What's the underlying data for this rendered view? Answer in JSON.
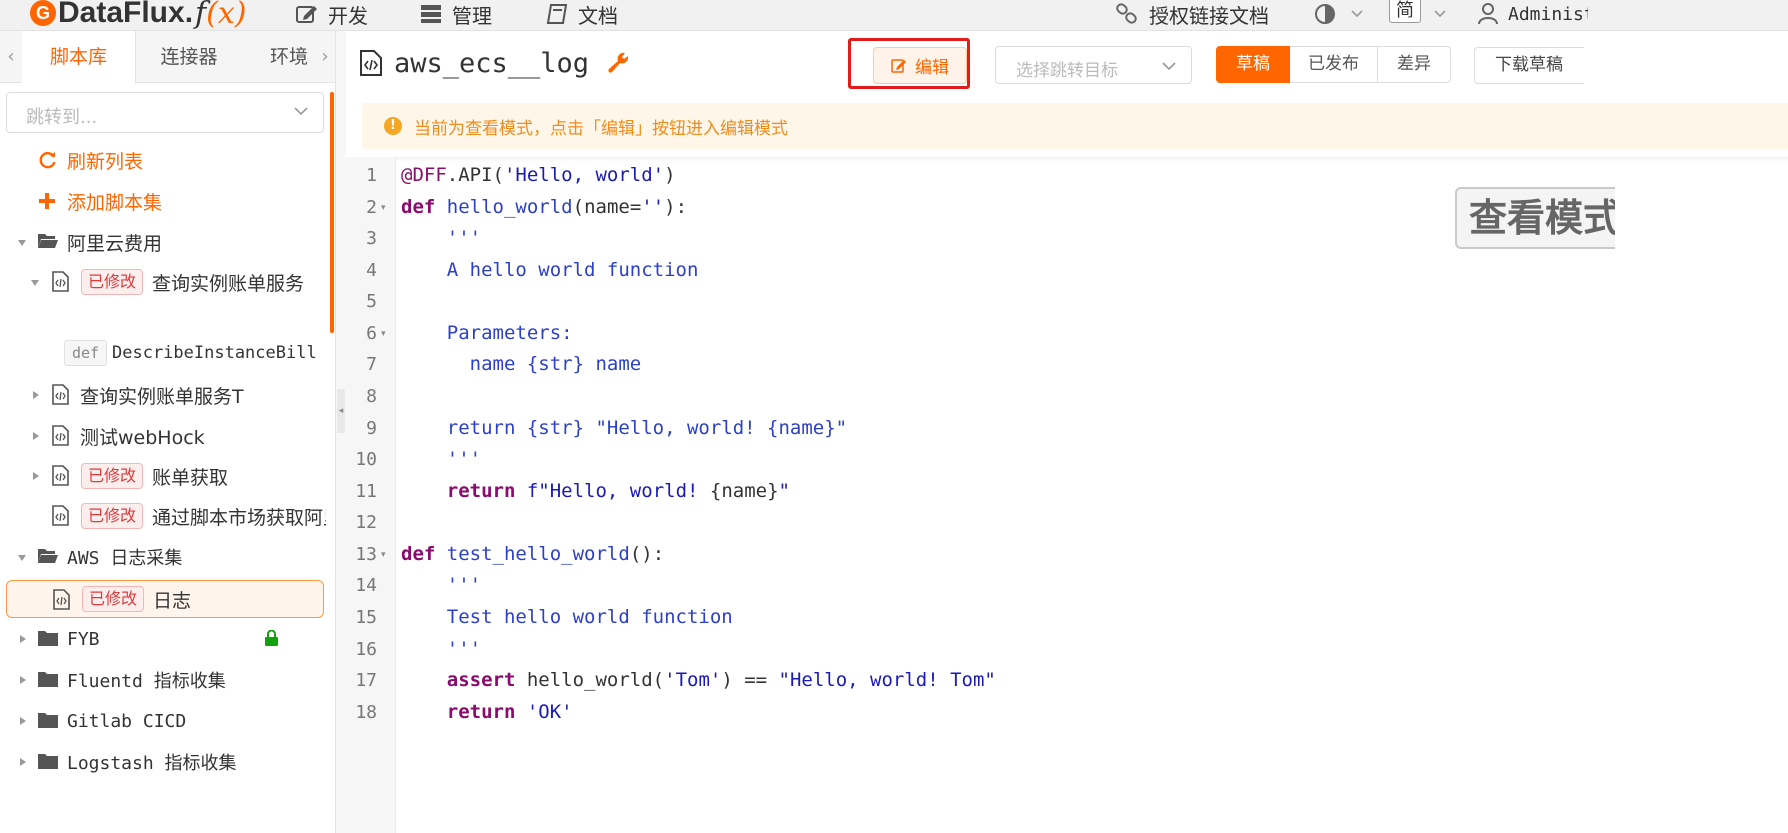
{
  "topbar": {
    "logo_text": "DataFlux.",
    "logo_fx": "f",
    "logo_x": "(x)",
    "nav": [
      "开发",
      "管理",
      "文档"
    ],
    "auth_doc_link": "授权链接文档",
    "lang": "简",
    "user": "Administrator"
  },
  "sidebar": {
    "tabs": [
      "脚本库",
      "连接器",
      "环境"
    ],
    "active_tab": "脚本库",
    "jump_placeholder": "跳转到...",
    "refresh": "刷新列表",
    "add_set": "添加脚本集",
    "items": [
      {
        "label": "阿里云费用",
        "type": "folder-open"
      },
      {
        "label": "查询实例账单服务",
        "type": "script",
        "badge": "已修改"
      },
      {
        "label": "DescribeInstanceBill",
        "type": "func",
        "badge": "def"
      },
      {
        "label": "查询实例账单服务T",
        "type": "script"
      },
      {
        "label": "测试webHock",
        "type": "script"
      },
      {
        "label": "账单获取",
        "type": "script",
        "badge": "已修改"
      },
      {
        "label": "通过脚本市场获取阿里",
        "type": "script",
        "badge": "已修改"
      },
      {
        "label": "AWS 日志采集",
        "type": "folder-open"
      },
      {
        "label": "日志",
        "type": "script",
        "badge": "已修改",
        "selected": true
      },
      {
        "label": "FYB",
        "type": "folder",
        "locked": true
      },
      {
        "label": "Fluentd 指标收集",
        "type": "folder"
      },
      {
        "label": "Gitlab CICD",
        "type": "folder"
      },
      {
        "label": "Logstash 指标收集",
        "type": "folder"
      }
    ]
  },
  "main": {
    "file_name": "aws_ecs__log",
    "edit_button": "编辑",
    "jump_target_placeholder": "选择跳转目标",
    "segments": [
      "草稿",
      "已发布",
      "差异"
    ],
    "active_segment": "草稿",
    "download_button": "下载草稿",
    "notice": "当前为查看模式，点击「编辑」按钮进入编辑模式",
    "view_mode_badge": "查看模式"
  },
  "code": {
    "line_numbers": [
      "1",
      "2",
      "3",
      "4",
      "5",
      "6",
      "7",
      "8",
      "9",
      "10",
      "11",
      "12",
      "13",
      "14",
      "15",
      "16",
      "17",
      "18"
    ],
    "l1_dec": "@DFF",
    "l1_rest": ".API(",
    "l1_str": "'Hello, world'",
    "l1_close": ")",
    "l2_kw": "def",
    "l2_fn": "hello_world",
    "l2_args": "(name=",
    "l2_str": "''",
    "l2_close": "):",
    "l3": "    '''",
    "l4": "    A hello world function",
    "l6": "    Parameters:",
    "l7": "      name {str} name",
    "l9": "    return {str} \"Hello, world! {name}\"",
    "l10": "    '''",
    "l11_kw": "return",
    "l11_str": "f\"Hello, world! ",
    "l11_mid": "{name}",
    "l11_end": "\"",
    "l13_kw": "def",
    "l13_fn": "test_hello_world",
    "l13_close": "():",
    "l14": "    '''",
    "l15": "    Test hello world function",
    "l16": "    '''",
    "l17_kw": "assert",
    "l17_mid": " hello_world(",
    "l17_str1": "'Tom'",
    "l17_op": ") == ",
    "l17_str2": "\"Hello, world! Tom\"",
    "l18_kw": "return",
    "l18_str": "'OK'"
  },
  "colors": {
    "accent": "#ff6600",
    "modified_badge": "#e03b3b",
    "notice_text": "#f08c1a",
    "highlight_outline": "#e21b1b"
  }
}
